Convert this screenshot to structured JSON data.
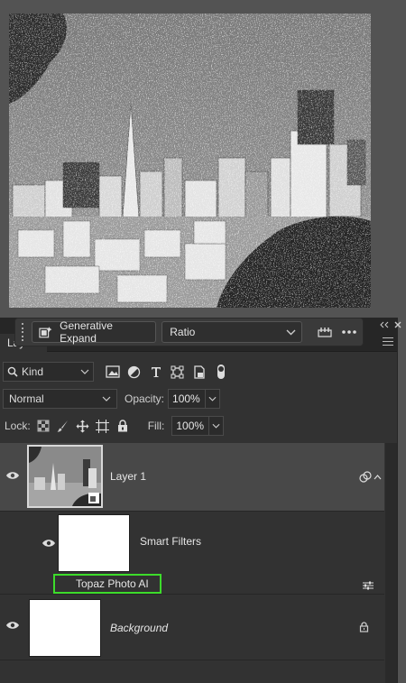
{
  "taskbar": {
    "generative_expand_label": "Generative Expand",
    "ratio_value": "Ratio",
    "settings_icon": "tune-icon",
    "more_icon": "more-icon"
  },
  "panel": {
    "tab_label": "Layers",
    "collapse_icon": "double-chevron-icon",
    "close_icon": "close-icon"
  },
  "filter": {
    "kind_label": "Kind"
  },
  "blend": {
    "mode": "Normal",
    "opacity_label": "Opacity:",
    "opacity_value": "100%"
  },
  "lock": {
    "label": "Lock:",
    "fill_label": "Fill:",
    "fill_value": "100%"
  },
  "layers": {
    "layer1_name": "Layer 1",
    "smart_filters_name": "Smart Filters",
    "filter_name": "Topaz Photo AI",
    "background_name": "Background"
  },
  "colors": {
    "panel_bg": "#323232",
    "selected_row": "#484848",
    "highlight_green": "#3ddc2b"
  }
}
